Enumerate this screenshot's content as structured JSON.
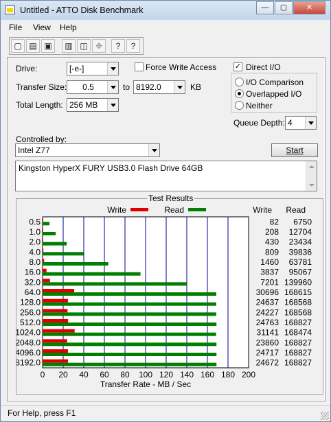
{
  "window": {
    "title": "Untitled - ATTO Disk Benchmark",
    "minimize": "—",
    "maximize": "▢",
    "close": "✕"
  },
  "menu": [
    "File",
    "View",
    "Help"
  ],
  "toolbar": {
    "new": "▢",
    "open": "▤",
    "save": "▣",
    "print": "▥",
    "preview": "◫",
    "move": "✥",
    "help": "?",
    "context_help": "?"
  },
  "settings": {
    "drive_label": "Drive:",
    "drive_value": "[-e-]",
    "force_write_label": "Force Write Access",
    "force_write_checked": false,
    "direct_io_label": "Direct I/O",
    "direct_io_checked": true,
    "transfer_size_label": "Transfer Size:",
    "transfer_from": "0.5",
    "to_label": "to",
    "transfer_to": "8192.0",
    "kb_label": "KB",
    "total_length_label": "Total Length:",
    "total_length_value": "256 MB",
    "io_comparison_label": "I/O Comparison",
    "overlapped_io_label": "Overlapped I/O",
    "neither_label": "Neither",
    "selected_mode": "Overlapped I/O",
    "queue_depth_label": "Queue Depth:",
    "queue_depth_value": "4",
    "controlled_by_label": "Controlled by:",
    "controlled_by_value": "Intel Z77",
    "start_label": "Start",
    "description": "Kingston HyperX FURY USB3.0 Flash Drive 64GB"
  },
  "results": {
    "title": "Test Results",
    "write_legend": "Write",
    "read_legend": "Read",
    "write_col": "Write",
    "read_col": "Read",
    "xlabel": "Transfer Rate - MB / Sec"
  },
  "chart_data": {
    "type": "bar",
    "orientation": "horizontal",
    "categories": [
      "0.5",
      "1.0",
      "2.0",
      "4.0",
      "8.0",
      "16.0",
      "32.0",
      "64.0",
      "128.0",
      "256.0",
      "512.0",
      "1024.0",
      "2048.0",
      "4096.0",
      "8192.0"
    ],
    "series": [
      {
        "name": "Write",
        "color": "#e00000",
        "values": [
          82,
          208,
          430,
          809,
          1460,
          3837,
          7201,
          30696,
          24637,
          24227,
          24763,
          31141,
          23860,
          24717,
          24672
        ]
      },
      {
        "name": "Read",
        "color": "#008000",
        "values": [
          6750,
          12704,
          23434,
          39836,
          63781,
          95067,
          139960,
          168615,
          168568,
          168568,
          168827,
          168474,
          168827,
          168827,
          168827
        ]
      }
    ],
    "value_unit_divisor": 1000,
    "xticks": [
      "0",
      "20",
      "40",
      "60",
      "80",
      "100",
      "120",
      "140",
      "160",
      "180",
      "200"
    ],
    "xlim": [
      0,
      200
    ],
    "xlabel": "Transfer Rate - MB / Sec",
    "grid": true,
    "legend": "top"
  },
  "status": {
    "text": "For Help, press F1"
  },
  "colors": {
    "write": "#e00000",
    "read": "#008000",
    "grid": "#00008b"
  }
}
